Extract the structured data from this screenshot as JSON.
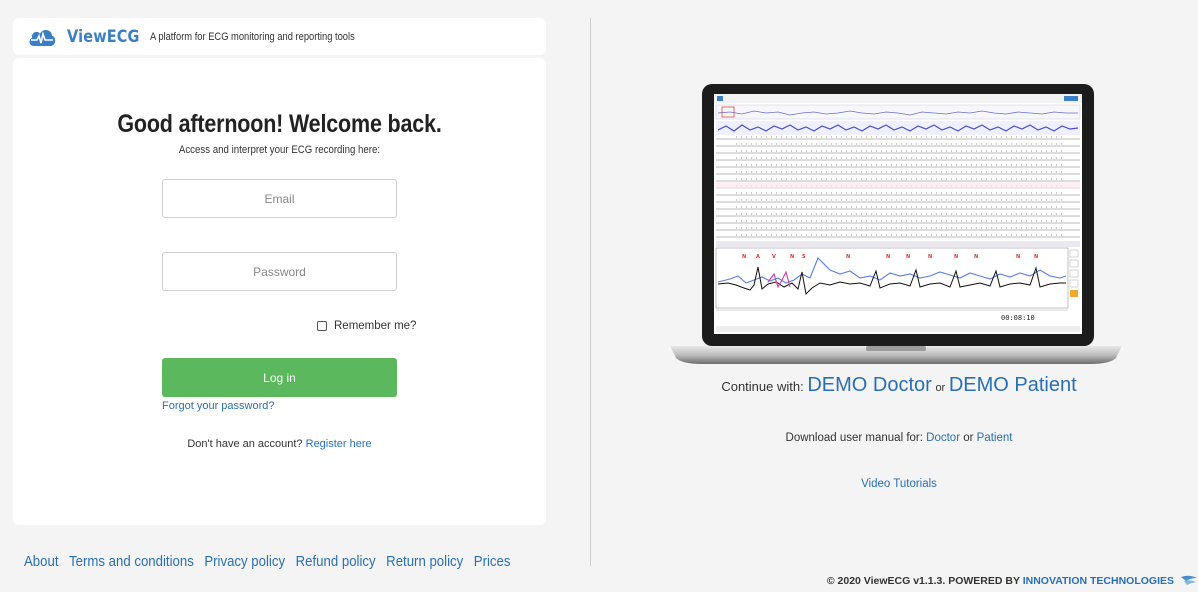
{
  "header": {
    "brand": "ViewECG",
    "tagline": "A platform for ECG monitoring and reporting tools"
  },
  "login": {
    "greeting": "Good afternoon! Welcome back.",
    "subtitle": "Access and interpret your ECG recording here:",
    "email_placeholder": "Email",
    "password_placeholder": "Password",
    "remember_label": "Remember me?",
    "login_label": "Log in",
    "forgot_label": "Forgot your password?",
    "no_account_text": "Don't have an account?",
    "register_label": "Register here"
  },
  "footer": {
    "links": [
      "About",
      "Terms and conditions",
      "Privacy policy",
      "Refund policy",
      "Return policy",
      "Prices"
    ]
  },
  "demo": {
    "continue_text": "Continue with:",
    "doctor_label": "DEMO Doctor",
    "or_text": "or",
    "patient_label": "DEMO Patient",
    "screen_time": "00:08:10",
    "manual_text": "Download user manual for:",
    "manual_doctor": "Doctor",
    "manual_or": "or",
    "manual_patient": "Patient",
    "video_tutorials": "Video Tutorials"
  },
  "copyright": {
    "text": "© 2020 ViewECG v1.1.3. POWERED BY",
    "company": "INNOVATION TECHNOLOGIES"
  },
  "colors": {
    "accent": "#2a6fb5",
    "brand": "#3b7fc4",
    "login_button": "#5cb85c",
    "page_bg": "#f4f4f4"
  },
  "icons": {
    "logo": "cloud-heartbeat-icon",
    "checkbox": "checkbox-icon",
    "company": "wing-icon"
  }
}
